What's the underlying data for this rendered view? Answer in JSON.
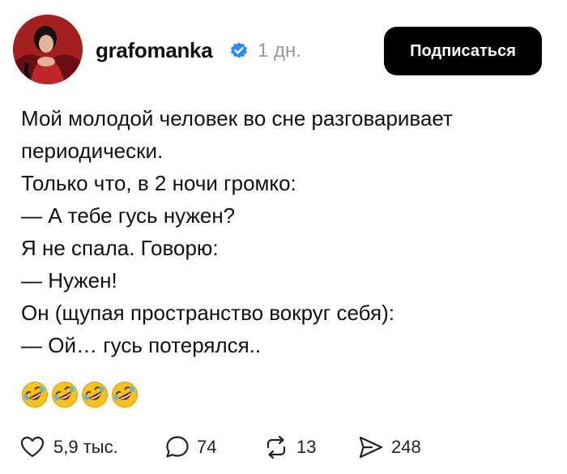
{
  "header": {
    "username": "grafomanka",
    "time": "1 дн.",
    "follow_label": "Подписаться"
  },
  "post": {
    "lines": [
      "Мой молодой человек во сне разговаривает",
      "периодически.",
      "Только что, в 2 ночи громко:",
      "— А тебе гусь нужен?",
      "Я не спала. Говорю:",
      "— Нужен!",
      "Он (щупая пространство вокруг себя):",
      "— Ой… гусь потерялся.."
    ],
    "emojis": [
      "rofl-emoji",
      "rofl-emoji",
      "rofl-emoji",
      "rofl-emoji"
    ]
  },
  "actions": {
    "likes": "5,9 тыс.",
    "comments": "74",
    "reposts": "13",
    "shares": "248"
  },
  "colors": {
    "verified_blue": "#2d8cff",
    "button_bg": "#000000",
    "muted_text": "#9a9a9a"
  }
}
